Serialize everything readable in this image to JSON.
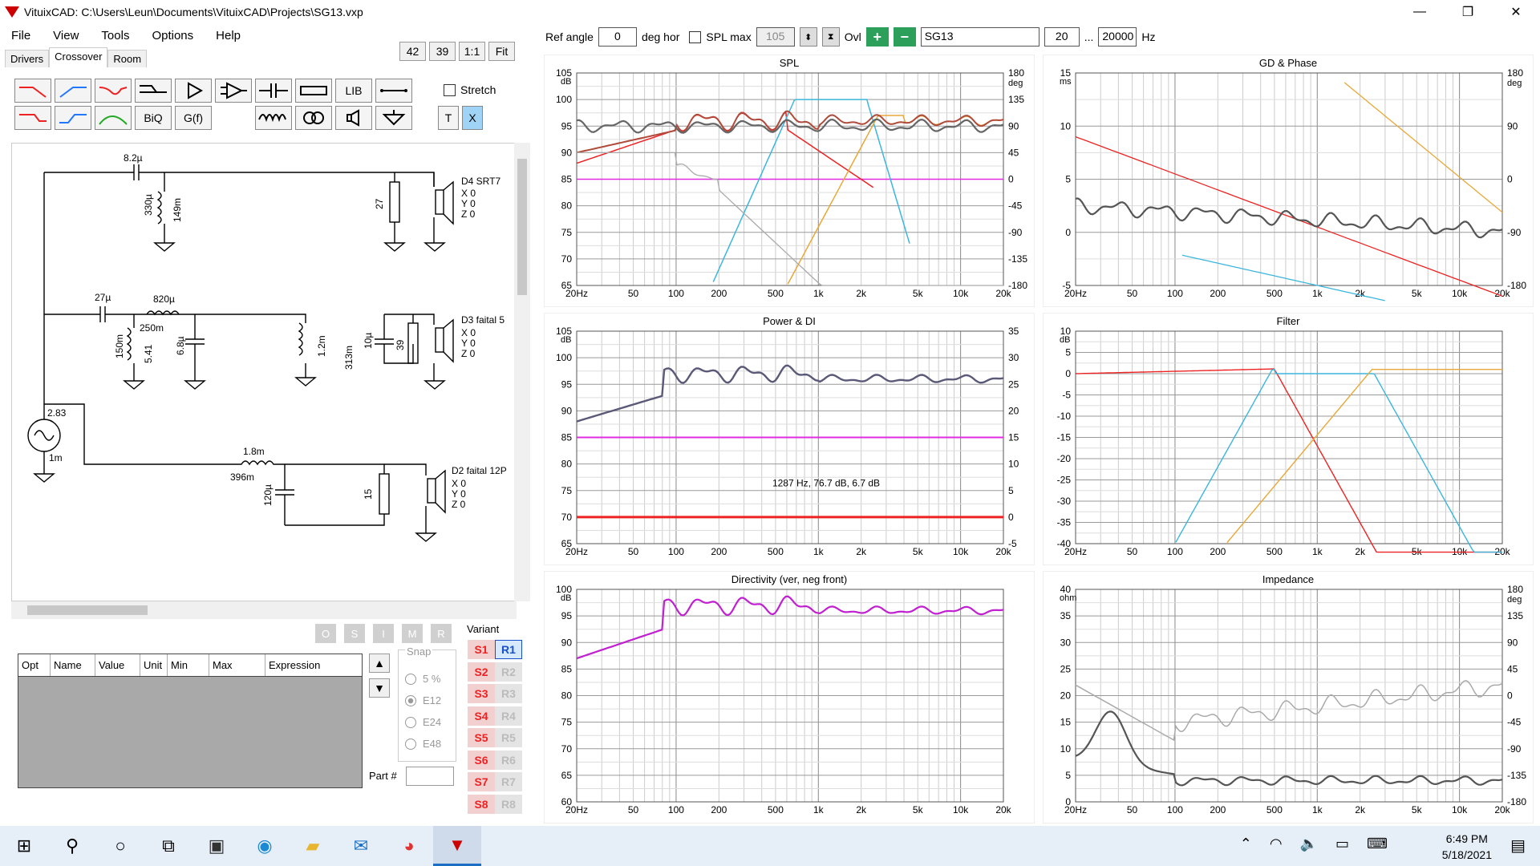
{
  "window": {
    "title": "VituixCAD: C:\\Users\\Leun\\Documents\\VituixCAD\\Projects\\SG13.vxp"
  },
  "menu": [
    "File",
    "View",
    "Tools",
    "Options",
    "Help"
  ],
  "tabs": [
    "Drivers",
    "Crossover",
    "Room"
  ],
  "zoom": [
    "42",
    "39",
    "1:1",
    "Fit"
  ],
  "tools": {
    "biq": "BiQ",
    "gf": "G(f)",
    "lib": "LIB",
    "t": "T",
    "x": "X",
    "stretch": "Stretch"
  },
  "schematic": {
    "labels": [
      "8.2µ",
      "330µ",
      "149m",
      "27",
      "D4 SRT7",
      "X 0",
      "Y 0",
      "Z 0",
      "27µ",
      "820µ",
      "250m",
      "150m",
      "5.41",
      "6.8µ",
      "1.2m",
      "313m",
      "10µ",
      "39",
      "D3 faital 5",
      "X 0",
      "Y 0",
      "Z 0",
      "2.83",
      "1m",
      "1.8m",
      "396m",
      "120µ",
      "15",
      "D2 faital 12P",
      "X 0",
      "Y 0",
      "Z 0"
    ]
  },
  "osirm": [
    "O",
    "S",
    "I",
    "M",
    "R"
  ],
  "ptable": {
    "headers": [
      "Opt",
      "Name",
      "Value",
      "Unit",
      "Min",
      "Max",
      "Expression"
    ]
  },
  "snap": {
    "label": "Snap",
    "options": [
      "5 %",
      "E12",
      "E24",
      "E48"
    ]
  },
  "part": "Part #",
  "variant": {
    "label": "Variant",
    "s": [
      "S1",
      "S2",
      "S3",
      "S4",
      "S5",
      "S6",
      "S7",
      "S8"
    ],
    "r": [
      "R1",
      "R2",
      "R3",
      "R4",
      "R5",
      "R6",
      "R7",
      "R8"
    ]
  },
  "topbar": {
    "ref_angle": "Ref angle",
    "angle": "0",
    "deg_hor": "deg hor",
    "splmax": "SPL max",
    "splmax_val": "105",
    "ovl": "Ovl",
    "name": "SG13",
    "fmin": "20",
    "dots": "...",
    "fmax": "20000",
    "hz": "Hz"
  },
  "plots": {
    "spl": {
      "title": "SPL",
      "yl": [
        "105",
        "100",
        "95",
        "90",
        "85",
        "80",
        "75",
        "70",
        "65"
      ],
      "yr": [
        "180",
        "135",
        "90",
        "45",
        "0",
        "-45",
        "-90",
        "-135",
        "-180"
      ],
      "yunit": "dB",
      "yrunit": "deg"
    },
    "gd": {
      "title": "GD & Phase",
      "yl": [
        "15",
        "10",
        "5",
        "0",
        "-5"
      ],
      "yr": [
        "180",
        "90",
        "0",
        "-90",
        "-180"
      ],
      "yunit": "ms",
      "yrunit": "deg"
    },
    "power": {
      "title": "Power & DI",
      "yl": [
        "105",
        "100",
        "95",
        "90",
        "85",
        "80",
        "75",
        "70",
        "65"
      ],
      "yr": [
        "35",
        "30",
        "25",
        "20",
        "15",
        "10",
        "5",
        "0",
        "-5"
      ],
      "yunit": "dB",
      "annot": "1287 Hz, 76.7 dB, 6.7 dB"
    },
    "filter": {
      "title": "Filter",
      "yl": [
        "10",
        "5",
        "0",
        "-5",
        "-10",
        "-15",
        "-20",
        "-25",
        "-30",
        "-35",
        "-40"
      ],
      "yunit": "dB"
    },
    "dir": {
      "title": "Directivity (ver, neg front)",
      "yl": [
        "100",
        "95",
        "90",
        "85",
        "80",
        "75",
        "70",
        "65",
        "60"
      ],
      "yunit": "dB"
    },
    "imp": {
      "title": "Impedance",
      "yl": [
        "40",
        "35",
        "30",
        "25",
        "20",
        "15",
        "10",
        "5",
        "0"
      ],
      "yr": [
        "180",
        "135",
        "90",
        "45",
        "0",
        "-45",
        "-90",
        "-135",
        "-180"
      ],
      "yunit": "ohm",
      "yrunit": "deg"
    },
    "x": [
      "20Hz",
      "50",
      "100",
      "200",
      "500",
      "1k",
      "2k",
      "5k",
      "10k",
      "20k"
    ]
  },
  "clock": {
    "time": "6:49 PM",
    "date": "5/18/2021"
  }
}
